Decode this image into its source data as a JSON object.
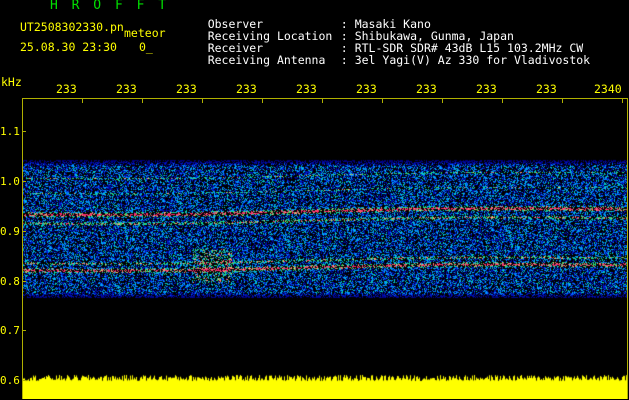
{
  "header": {
    "app_title": "H R O F F T",
    "filename": "UT2508302330.pn",
    "meteor_label": "meteor",
    "datetime": "25.08.30 23:30",
    "counter": "0_"
  },
  "info": [
    {
      "key": "Observer",
      "sep": ":",
      "value": "Masaki Kano"
    },
    {
      "key": "Receiving Location",
      "sep": ":",
      "value": "Shibukawa, Gunma, Japan"
    },
    {
      "key": "Receiver",
      "sep": ":",
      "value": "RTL-SDR SDR# 43dB L15 103.2MHz CW"
    },
    {
      "key": "Receiving Antenna",
      "sep": ":",
      "value": "3el Yagi(V) Az 330 for Vladivostok"
    }
  ],
  "axes": {
    "y_unit": "kHz",
    "x_ticks": [
      "233",
      "233",
      "233",
      "233",
      "233",
      "233",
      "233",
      "233",
      "233",
      "2340"
    ],
    "y_ticks": [
      "1.1",
      "1.0",
      "0.9",
      "0.8",
      "0.7",
      "0.6"
    ]
  },
  "colors": {
    "text_primary": "#ffffff",
    "title": "#00e000",
    "axis": "#ffff00",
    "background": "#000000",
    "noise_band": "#1a3cff",
    "echo_line": "#ff2a6e",
    "signal_bar": "#ffff00"
  }
}
